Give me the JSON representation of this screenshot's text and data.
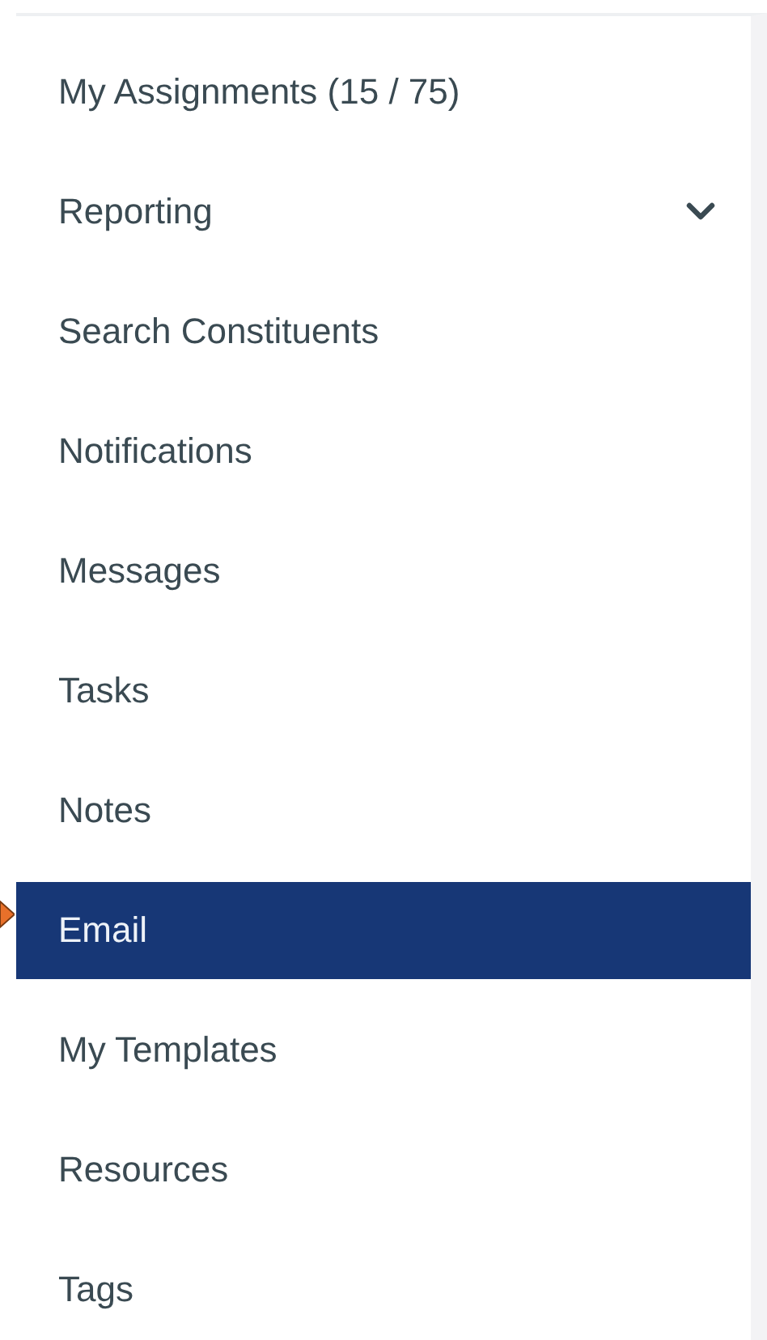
{
  "menu": {
    "items": [
      {
        "label": "My Assignments (15 / 75)",
        "kind": "link",
        "selected": false
      },
      {
        "label": "Reporting",
        "kind": "expandable",
        "expanded": false,
        "selected": false
      },
      {
        "label": "Search Constituents",
        "kind": "link",
        "selected": false
      },
      {
        "label": "Notifications",
        "kind": "link",
        "selected": false
      },
      {
        "label": "Messages",
        "kind": "link",
        "selected": false
      },
      {
        "label": "Tasks",
        "kind": "link",
        "selected": false
      },
      {
        "label": "Notes",
        "kind": "link",
        "selected": false
      },
      {
        "label": "Email",
        "kind": "link",
        "selected": true
      },
      {
        "label": "My Templates",
        "kind": "link",
        "selected": false
      },
      {
        "label": "Resources",
        "kind": "link",
        "selected": false
      },
      {
        "label": "Tags",
        "kind": "link",
        "selected": false
      }
    ]
  }
}
